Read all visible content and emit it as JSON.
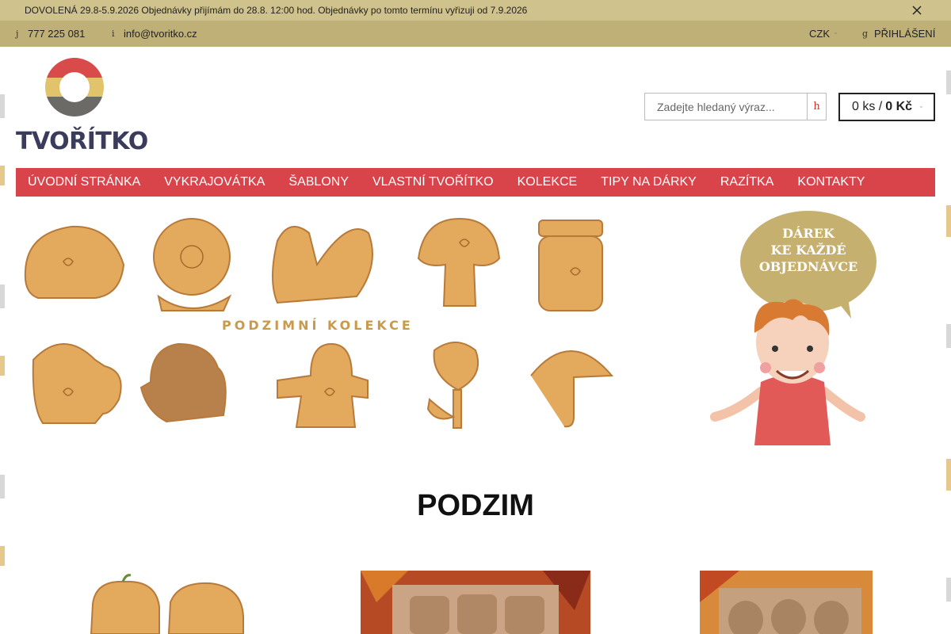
{
  "notice": {
    "text": "DOVOLENÁ 29.8-5.9.2026  Objednávky přijímám do 28.8. 12:00 hod. Objednávky po tomto termínu vyřizuji od 7.9.2026"
  },
  "topbar": {
    "phone_icon": "j",
    "phone": "777 225 081",
    "email_icon": "i",
    "email": "info@tvoritko.cz",
    "currency": "CZK",
    "login_icon": "g",
    "login": "PŘIHLÁŠENÍ"
  },
  "logo": {
    "text": "TVOŘÍTKO"
  },
  "search": {
    "placeholder": "Zadejte hledaný výraz...",
    "button_glyph": "h"
  },
  "cart": {
    "count": "0 ks /",
    "price": "0 Kč"
  },
  "nav": {
    "items": [
      "ÚVODNÍ STRÁNKA",
      "VYKRAJOVÁTKA",
      "ŠABLONY",
      "VLASTNÍ TVOŘÍTKO",
      "KOLEKCE",
      "TIPY NA DÁRKY",
      "RAZÍTKA",
      "KONTAKTY"
    ]
  },
  "banner": {
    "caption": "PODZIMNÍ KOLEKCE"
  },
  "gift": {
    "line1": "DÁREK",
    "line2": "KE KAŽDÉ",
    "line3": "OBJEDNÁVCE"
  },
  "section": {
    "heading": "PODZIM"
  },
  "colors": {
    "accent": "#d9434a",
    "topbar": "#bfb077",
    "notice": "#cfc28c",
    "cookie": "#e3a95c"
  }
}
